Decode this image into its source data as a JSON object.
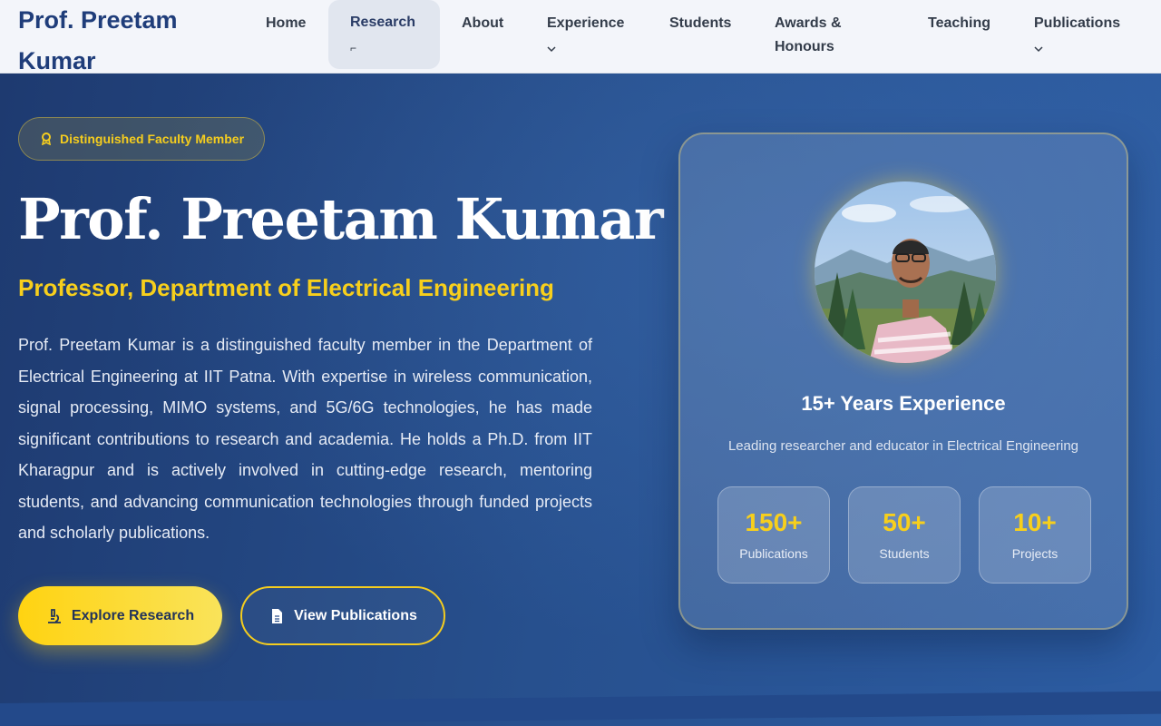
{
  "brand": "Prof. Preetam Kumar",
  "nav": {
    "home": "Home",
    "research": "Research",
    "about": "About",
    "experience": "Experience",
    "students": "Students",
    "awards": "Awards & Honours",
    "teaching": "Teaching",
    "publications": "Publications"
  },
  "hero": {
    "badge": "Distinguished Faculty Member",
    "name": "Prof. Preetam Kumar",
    "role": "Professor, Department of Electrical Engineering",
    "description": "Prof. Preetam Kumar is a distinguished faculty member in the Department of Electrical Engineering at IIT Patna. With expertise in wireless communication, signal processing, MIMO systems, and 5G/6G technologies, he has made significant contributions to research and academia. He holds a Ph.D. from IIT Kharagpur and is actively involved in cutting-edge research, mentoring students, and advancing communication technologies through funded projects and scholarly publications.",
    "primary_button": "Explore Research",
    "secondary_button": "View Publications"
  },
  "card": {
    "title": "15+ Years Experience",
    "subtitle": "Leading researcher and educator in Electrical Engineering",
    "stats": [
      {
        "value": "150+",
        "label": "Publications"
      },
      {
        "value": "50+",
        "label": "Students"
      },
      {
        "value": "10+",
        "label": "Projects"
      }
    ]
  },
  "colors": {
    "accent": "#f7cf1c",
    "brand": "#1f3d7a",
    "hero_bg": "#27508e"
  }
}
